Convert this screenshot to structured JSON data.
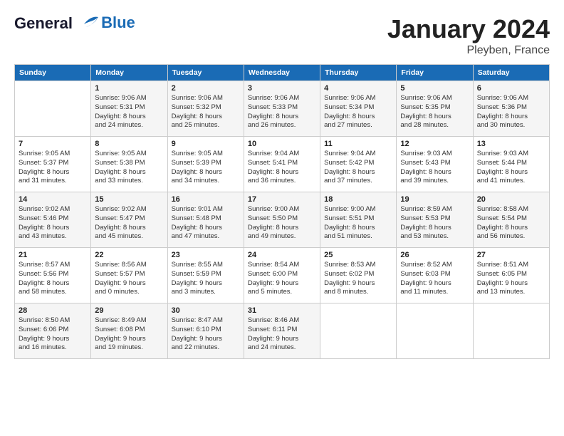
{
  "header": {
    "logo_line1": "General",
    "logo_line2": "Blue",
    "month": "January 2024",
    "location": "Pleyben, France"
  },
  "weekdays": [
    "Sunday",
    "Monday",
    "Tuesday",
    "Wednesday",
    "Thursday",
    "Friday",
    "Saturday"
  ],
  "weeks": [
    [
      {
        "day": "",
        "info": ""
      },
      {
        "day": "1",
        "info": "Sunrise: 9:06 AM\nSunset: 5:31 PM\nDaylight: 8 hours\nand 24 minutes."
      },
      {
        "day": "2",
        "info": "Sunrise: 9:06 AM\nSunset: 5:32 PM\nDaylight: 8 hours\nand 25 minutes."
      },
      {
        "day": "3",
        "info": "Sunrise: 9:06 AM\nSunset: 5:33 PM\nDaylight: 8 hours\nand 26 minutes."
      },
      {
        "day": "4",
        "info": "Sunrise: 9:06 AM\nSunset: 5:34 PM\nDaylight: 8 hours\nand 27 minutes."
      },
      {
        "day": "5",
        "info": "Sunrise: 9:06 AM\nSunset: 5:35 PM\nDaylight: 8 hours\nand 28 minutes."
      },
      {
        "day": "6",
        "info": "Sunrise: 9:06 AM\nSunset: 5:36 PM\nDaylight: 8 hours\nand 30 minutes."
      }
    ],
    [
      {
        "day": "7",
        "info": "Sunrise: 9:05 AM\nSunset: 5:37 PM\nDaylight: 8 hours\nand 31 minutes."
      },
      {
        "day": "8",
        "info": "Sunrise: 9:05 AM\nSunset: 5:38 PM\nDaylight: 8 hours\nand 33 minutes."
      },
      {
        "day": "9",
        "info": "Sunrise: 9:05 AM\nSunset: 5:39 PM\nDaylight: 8 hours\nand 34 minutes."
      },
      {
        "day": "10",
        "info": "Sunrise: 9:04 AM\nSunset: 5:41 PM\nDaylight: 8 hours\nand 36 minutes."
      },
      {
        "day": "11",
        "info": "Sunrise: 9:04 AM\nSunset: 5:42 PM\nDaylight: 8 hours\nand 37 minutes."
      },
      {
        "day": "12",
        "info": "Sunrise: 9:03 AM\nSunset: 5:43 PM\nDaylight: 8 hours\nand 39 minutes."
      },
      {
        "day": "13",
        "info": "Sunrise: 9:03 AM\nSunset: 5:44 PM\nDaylight: 8 hours\nand 41 minutes."
      }
    ],
    [
      {
        "day": "14",
        "info": "Sunrise: 9:02 AM\nSunset: 5:46 PM\nDaylight: 8 hours\nand 43 minutes."
      },
      {
        "day": "15",
        "info": "Sunrise: 9:02 AM\nSunset: 5:47 PM\nDaylight: 8 hours\nand 45 minutes."
      },
      {
        "day": "16",
        "info": "Sunrise: 9:01 AM\nSunset: 5:48 PM\nDaylight: 8 hours\nand 47 minutes."
      },
      {
        "day": "17",
        "info": "Sunrise: 9:00 AM\nSunset: 5:50 PM\nDaylight: 8 hours\nand 49 minutes."
      },
      {
        "day": "18",
        "info": "Sunrise: 9:00 AM\nSunset: 5:51 PM\nDaylight: 8 hours\nand 51 minutes."
      },
      {
        "day": "19",
        "info": "Sunrise: 8:59 AM\nSunset: 5:53 PM\nDaylight: 8 hours\nand 53 minutes."
      },
      {
        "day": "20",
        "info": "Sunrise: 8:58 AM\nSunset: 5:54 PM\nDaylight: 8 hours\nand 56 minutes."
      }
    ],
    [
      {
        "day": "21",
        "info": "Sunrise: 8:57 AM\nSunset: 5:56 PM\nDaylight: 8 hours\nand 58 minutes."
      },
      {
        "day": "22",
        "info": "Sunrise: 8:56 AM\nSunset: 5:57 PM\nDaylight: 9 hours\nand 0 minutes."
      },
      {
        "day": "23",
        "info": "Sunrise: 8:55 AM\nSunset: 5:59 PM\nDaylight: 9 hours\nand 3 minutes."
      },
      {
        "day": "24",
        "info": "Sunrise: 8:54 AM\nSunset: 6:00 PM\nDaylight: 9 hours\nand 5 minutes."
      },
      {
        "day": "25",
        "info": "Sunrise: 8:53 AM\nSunset: 6:02 PM\nDaylight: 9 hours\nand 8 minutes."
      },
      {
        "day": "26",
        "info": "Sunrise: 8:52 AM\nSunset: 6:03 PM\nDaylight: 9 hours\nand 11 minutes."
      },
      {
        "day": "27",
        "info": "Sunrise: 8:51 AM\nSunset: 6:05 PM\nDaylight: 9 hours\nand 13 minutes."
      }
    ],
    [
      {
        "day": "28",
        "info": "Sunrise: 8:50 AM\nSunset: 6:06 PM\nDaylight: 9 hours\nand 16 minutes."
      },
      {
        "day": "29",
        "info": "Sunrise: 8:49 AM\nSunset: 6:08 PM\nDaylight: 9 hours\nand 19 minutes."
      },
      {
        "day": "30",
        "info": "Sunrise: 8:47 AM\nSunset: 6:10 PM\nDaylight: 9 hours\nand 22 minutes."
      },
      {
        "day": "31",
        "info": "Sunrise: 8:46 AM\nSunset: 6:11 PM\nDaylight: 9 hours\nand 24 minutes."
      },
      {
        "day": "",
        "info": ""
      },
      {
        "day": "",
        "info": ""
      },
      {
        "day": "",
        "info": ""
      }
    ]
  ]
}
